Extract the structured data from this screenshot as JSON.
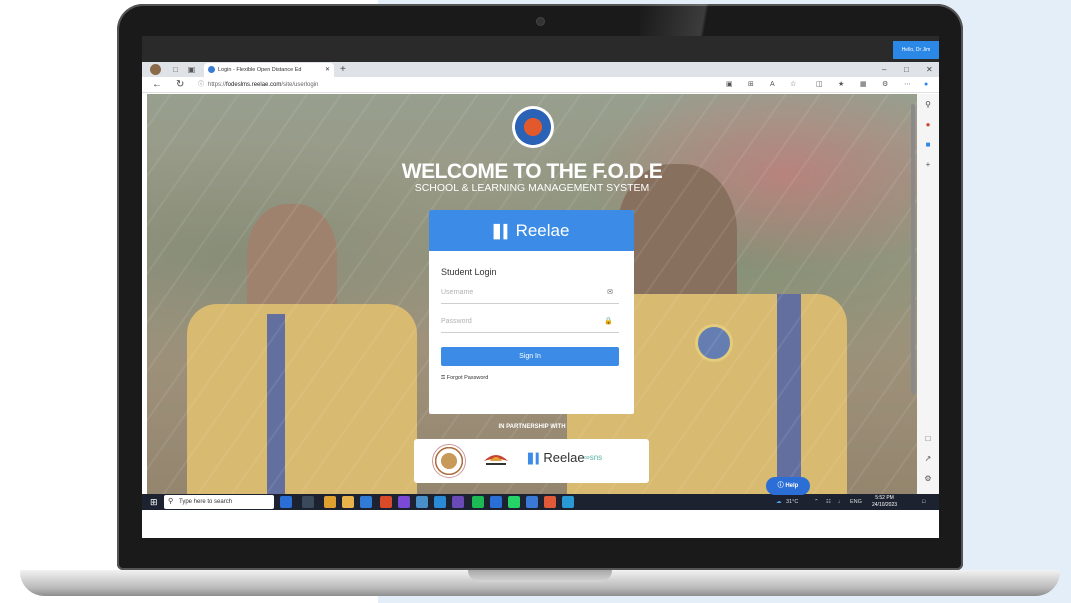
{
  "browser": {
    "greeting": "Hello, Dr Jim",
    "tab_title": "Login - Flexible Open Distance Ed",
    "url_prefix": "https://",
    "url_host": "fodeslms.reelae.com",
    "url_path": "/site/userlogin"
  },
  "page": {
    "welcome": "WELCOME TO THE F.O.D.E",
    "subtitle": "SCHOOL & LEARNING MANAGEMENT SYSTEM",
    "partnership": "IN PARTNERSHIP WITH"
  },
  "login_card": {
    "brand": "Reelae",
    "title": "Student Login",
    "username_placeholder": "Username",
    "password_placeholder": "Password",
    "sign_in": "Sign In",
    "forgot": "Forgot Password"
  },
  "partners": {
    "reelae": "Reelae",
    "sns": "sns"
  },
  "taskbar": {
    "search": "Type here to search",
    "temperature": "31°C",
    "lang": "ENG",
    "time": "5:52 PM",
    "date": "24/10/2023"
  },
  "help_button": "Help",
  "colors": {
    "accent": "#3c8ce7",
    "help": "#2b6fd6"
  }
}
